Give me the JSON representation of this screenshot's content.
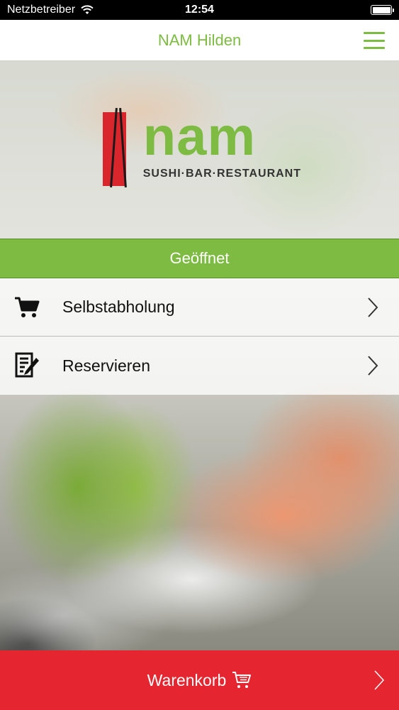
{
  "status_bar": {
    "carrier": "Netzbetreiber",
    "time": "12:54",
    "battery_level": 1.0
  },
  "header": {
    "title": "NAM Hilden",
    "menu_icon": "hamburger-icon"
  },
  "logo": {
    "word": "nam",
    "subtitle": "SUSHI·BAR·RESTAURANT"
  },
  "status": {
    "label": "Geöffnet"
  },
  "menu": {
    "items": [
      {
        "label": "Selbstabholung",
        "icon": "cart-icon"
      },
      {
        "label": "Reservieren",
        "icon": "edit-document-icon"
      }
    ]
  },
  "cart": {
    "label": "Warenkorb",
    "icon": "cart-icon"
  },
  "colors": {
    "brand_green": "#7dbb43",
    "cart_red": "#e5252f",
    "logo_red": "#d8262c"
  }
}
